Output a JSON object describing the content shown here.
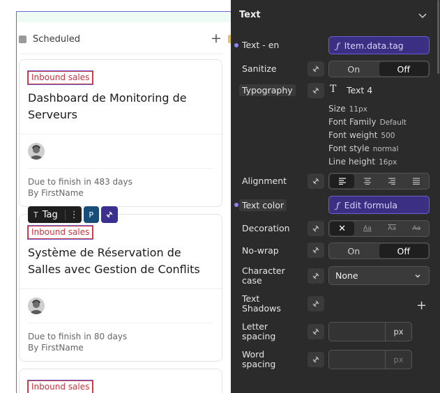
{
  "board": {
    "column_title": "Scheduled",
    "cards": [
      {
        "tag": "Inbound sales",
        "title": "Dashboard de Monitoring de Serveurs",
        "due": "Due to finish in 483 days",
        "by": "By FirstName"
      },
      {
        "tag": "Inbound sales",
        "title": "Système de Réservation de Salles avec Gestion de Conflits",
        "due": "Due to finish in 80 days",
        "by": "By FirstName"
      },
      {
        "tag": "Inbound sales"
      }
    ],
    "toolbar": {
      "label": "Tag",
      "badge": "P"
    }
  },
  "panel": {
    "title": "Text",
    "text_label": "Text - en",
    "text_formula": "Item.data.tag",
    "sanitize": {
      "label": "Sanitize",
      "on": "On",
      "off": "Off"
    },
    "typography": {
      "label": "Typography",
      "name": "Text 4",
      "size_label": "Size",
      "size": "11px",
      "family_label": "Font Family",
      "family": "Default",
      "weight_label": "Font weight",
      "weight": "500",
      "style_label": "Font style",
      "style": "normal",
      "line_label": "Line height",
      "line": "16px"
    },
    "alignment_label": "Alignment",
    "text_color": {
      "label": "Text color",
      "button": "Edit formula"
    },
    "decoration_label": "Decoration",
    "decoration_options": [
      "Aa",
      "Aa",
      "Aa"
    ],
    "nowrap": {
      "label": "No-wrap",
      "on": "On",
      "off": "Off"
    },
    "character_case": {
      "label_1": "Character",
      "label_2": "case",
      "value": "None"
    },
    "text_shadows": {
      "label_1": "Text",
      "label_2": "Shadows"
    },
    "letter_spacing": {
      "label_1": "Letter",
      "label_2": "spacing",
      "unit": "px"
    },
    "word_spacing": {
      "label_1": "Word",
      "label_2": "spacing",
      "unit": "px"
    }
  },
  "colors": {
    "accent": "#6b63d6",
    "tag_red": "#d0303c",
    "panel_bg": "#2b2b2b",
    "formula_bg": "#3a2f82"
  }
}
